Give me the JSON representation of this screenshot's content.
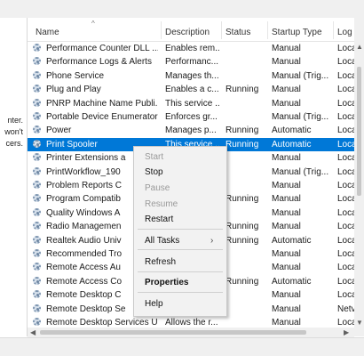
{
  "left_pane": [
    "nter.",
    "won't",
    "cers."
  ],
  "columns": [
    "Name",
    "Description",
    "Status",
    "Startup Type",
    "Log"
  ],
  "services": [
    {
      "name": "Performance Counter DLL ...",
      "desc": "Enables rem...",
      "status": "",
      "startup": "Manual",
      "log": "Loca"
    },
    {
      "name": "Performance Logs & Alerts",
      "desc": "Performanc...",
      "status": "",
      "startup": "Manual",
      "log": "Loca"
    },
    {
      "name": "Phone Service",
      "desc": "Manages th...",
      "status": "",
      "startup": "Manual (Trig...",
      "log": "Loca"
    },
    {
      "name": "Plug and Play",
      "desc": "Enables a c...",
      "status": "Running",
      "startup": "Manual",
      "log": "Loca"
    },
    {
      "name": "PNRP Machine Name Publi...",
      "desc": "This service ...",
      "status": "",
      "startup": "Manual",
      "log": "Loca"
    },
    {
      "name": "Portable Device Enumerator...",
      "desc": "Enforces gr...",
      "status": "",
      "startup": "Manual (Trig...",
      "log": "Loca"
    },
    {
      "name": "Power",
      "desc": "Manages p...",
      "status": "Running",
      "startup": "Automatic",
      "log": "Loca"
    },
    {
      "name": "Print Spooler",
      "desc": "This service ...",
      "status": "Running",
      "startup": "Automatic",
      "log": "Loca"
    },
    {
      "name": "Printer Extensions a",
      "desc": "",
      "status": "",
      "startup": "Manual",
      "log": "Loca"
    },
    {
      "name": "PrintWorkflow_190",
      "desc": "",
      "status": "",
      "startup": "Manual (Trig...",
      "log": "Loca"
    },
    {
      "name": "Problem Reports C",
      "desc": "",
      "status": "",
      "startup": "Manual",
      "log": "Loca"
    },
    {
      "name": "Program Compatib",
      "desc": "",
      "status": "Running",
      "startup": "Manual",
      "log": "Loca"
    },
    {
      "name": "Quality Windows A",
      "desc": "",
      "status": "",
      "startup": "Manual",
      "log": "Loca"
    },
    {
      "name": "Radio Managemen",
      "desc": "",
      "status": "Running",
      "startup": "Manual",
      "log": "Loca"
    },
    {
      "name": "Realtek Audio Univ",
      "desc": "",
      "status": "Running",
      "startup": "Automatic",
      "log": "Loca"
    },
    {
      "name": "Recommended Tro",
      "desc": "",
      "status": "",
      "startup": "Manual",
      "log": "Loca"
    },
    {
      "name": "Remote Access Au",
      "desc": "",
      "status": "",
      "startup": "Manual",
      "log": "Loca"
    },
    {
      "name": "Remote Access Co",
      "desc": "",
      "status": "Running",
      "startup": "Automatic",
      "log": "Loca"
    },
    {
      "name": "Remote Desktop C",
      "desc": "",
      "status": "",
      "startup": "Manual",
      "log": "Loca"
    },
    {
      "name": "Remote Desktop Se",
      "desc": "",
      "status": "",
      "startup": "Manual",
      "log": "Netv"
    },
    {
      "name": "Remote Desktop Services U...",
      "desc": "Allows the r...",
      "status": "",
      "startup": "Manual",
      "log": "Loca"
    }
  ],
  "selected_index": 7,
  "menu": {
    "start": "Start",
    "stop": "Stop",
    "pause": "Pause",
    "resume": "Resume",
    "restart": "Restart",
    "all_tasks": "All Tasks",
    "refresh": "Refresh",
    "properties": "Properties",
    "help": "Help"
  },
  "colors": {
    "selection": "#0078d7",
    "menu_bg": "#f2f2f2",
    "chrome": "#f0f0f0"
  }
}
